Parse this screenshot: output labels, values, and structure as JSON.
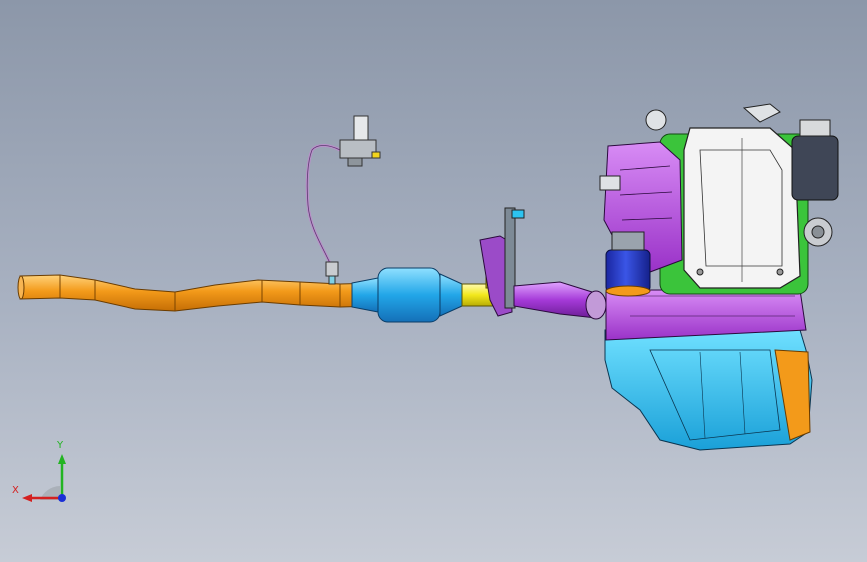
{
  "viewport": {
    "background_top": "#8c97a9",
    "background_bottom": "#c7ccd6"
  },
  "triad": {
    "x_label": "X",
    "y_label": "Y",
    "x_color": "#d42020",
    "y_color": "#22b422",
    "z_color": "#1a2fd6"
  },
  "parts": {
    "exhaust_pipe": {
      "color": "#f39a1a"
    },
    "catalytic_converter": {
      "color": "#22a6e8"
    },
    "flex_section": {
      "color": "#a53ad8"
    },
    "y_pipe": {
      "color": "#f2e81c"
    },
    "sensor_harness": {
      "color": "#b98fc9"
    },
    "engine_block": {
      "color": "#b64be0"
    },
    "oil_pan": {
      "color": "#2cc3f0"
    },
    "cylinder_head_cover": {
      "color": "#f4f4f4"
    },
    "intercooler": {
      "color": "#2b3cc8"
    },
    "trim_green": {
      "color": "#3bc43b"
    },
    "sensor_module": {
      "color": "#9aa3ad"
    }
  }
}
